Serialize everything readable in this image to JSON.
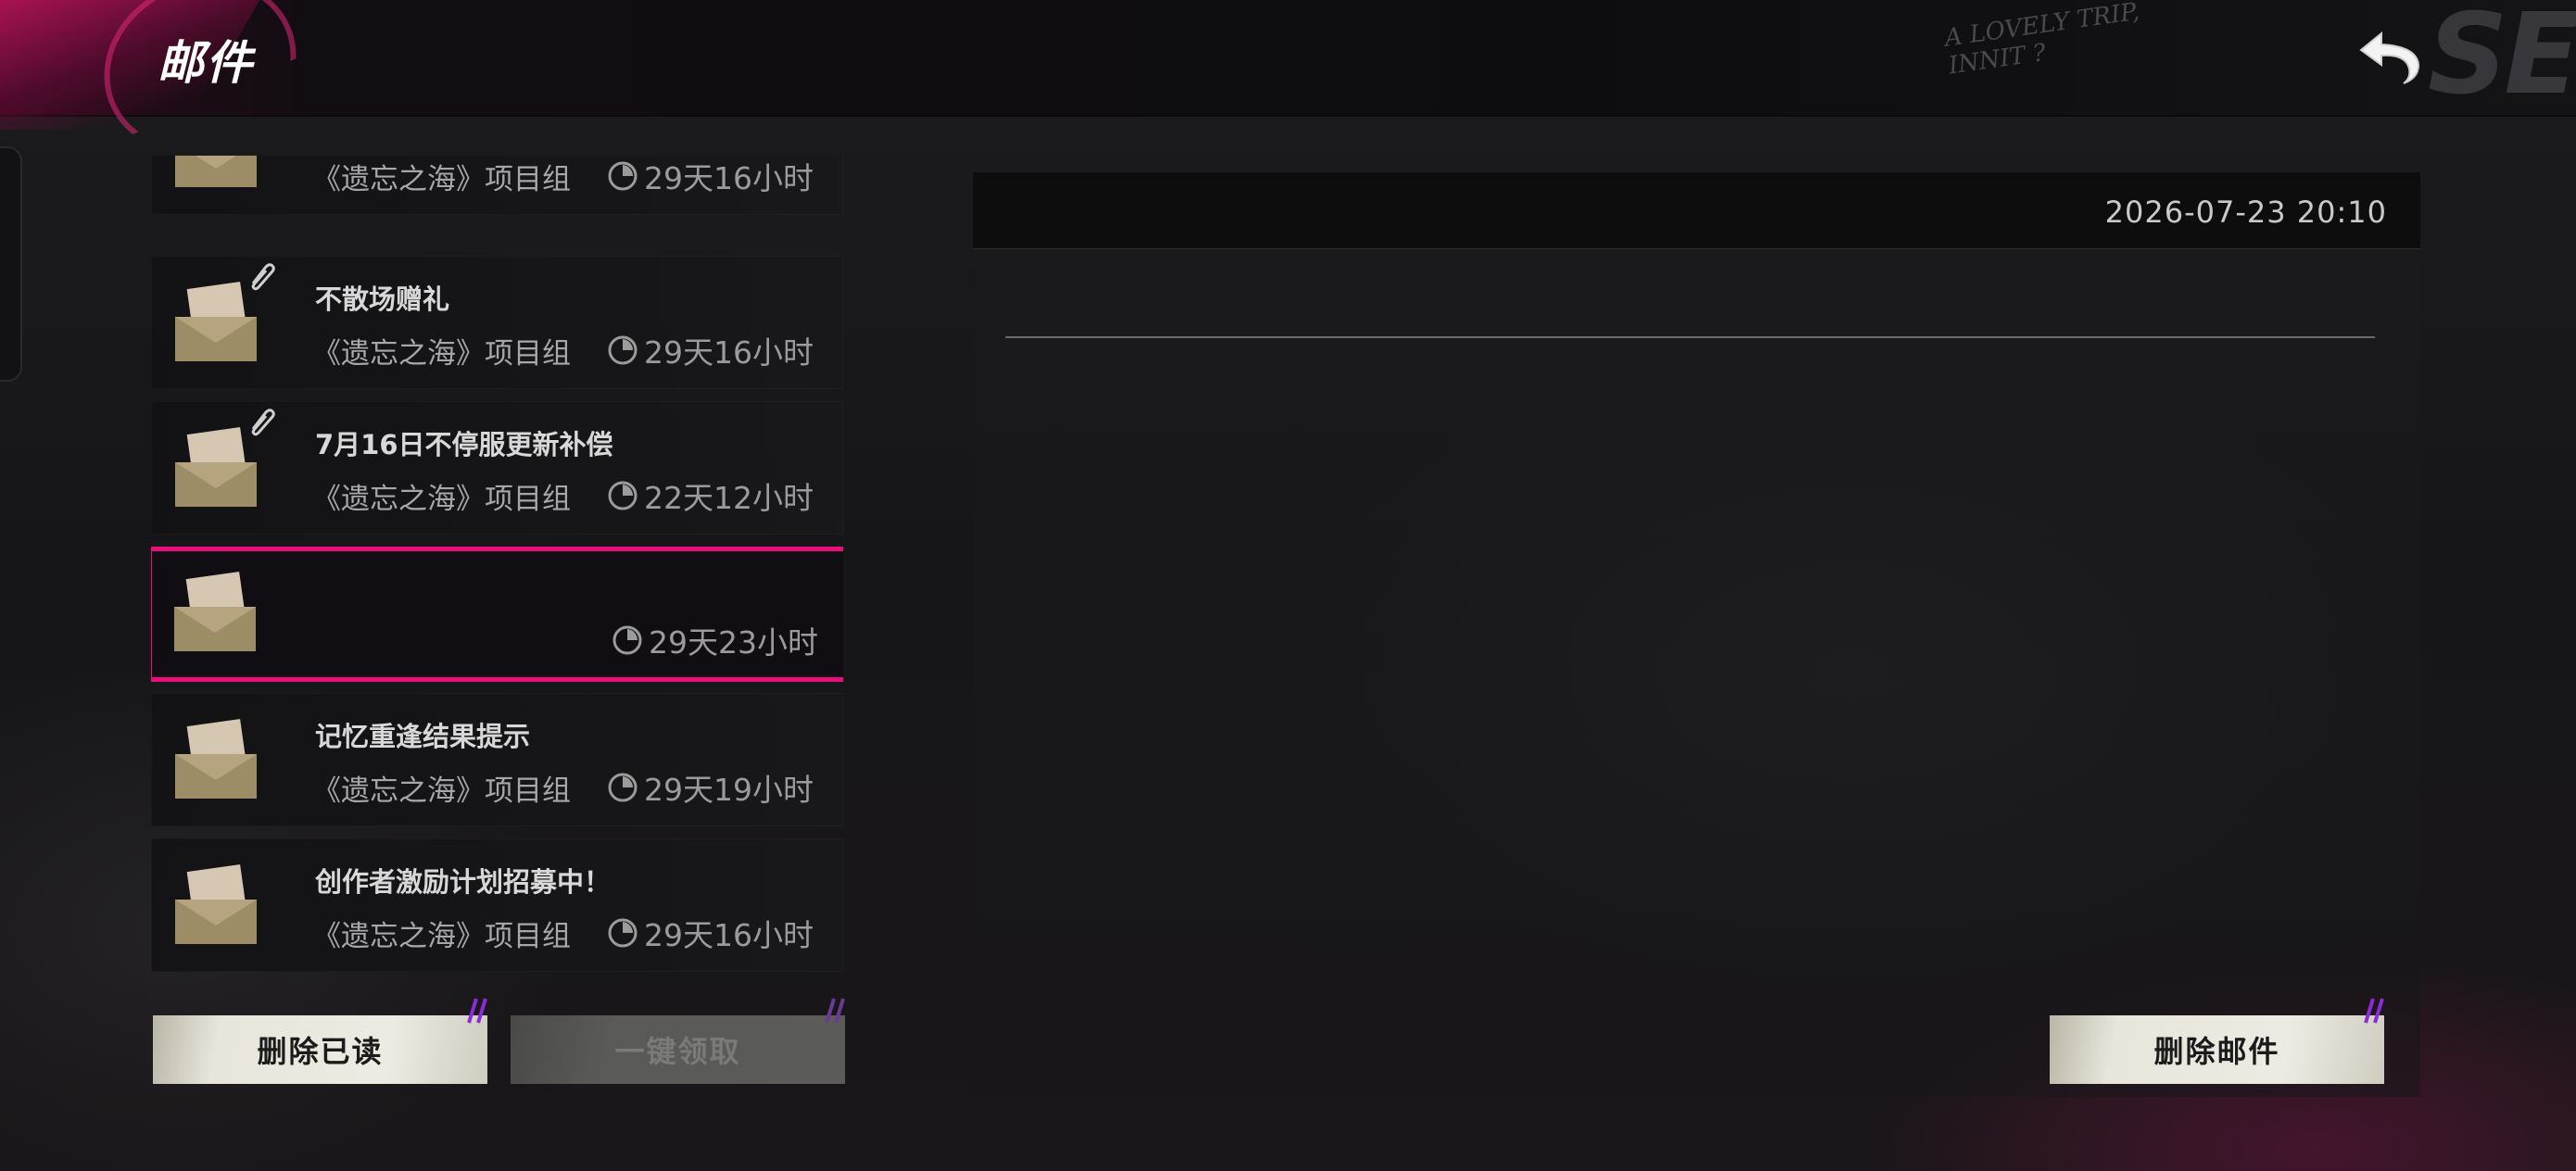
{
  "header": {
    "title": "邮件",
    "deco_lines": [
      "A LOVELY TRIP,",
      "INNIT ?"
    ],
    "deco_mark": "SE"
  },
  "colors": {
    "accent_pink": "#ea0f78",
    "accent_purple": "#8a2bd6",
    "button_light": "#ecebe3"
  },
  "mails": [
    {
      "title": "",
      "sender": "《遗忘之海》项目组",
      "time": "29天16小时",
      "has_attachment": false,
      "selected": false
    },
    {
      "title": "不散场赠礼",
      "sender": "《遗忘之海》项目组",
      "time": "29天16小时",
      "has_attachment": true,
      "selected": false
    },
    {
      "title": "7月16日不停服更新补偿",
      "sender": "《遗忘之海》项目组",
      "time": "22天12小时",
      "has_attachment": true,
      "selected": false
    },
    {
      "title": "",
      "sender": "",
      "time": "29天23小时",
      "has_attachment": false,
      "selected": true
    },
    {
      "title": "记忆重逢结果提示",
      "sender": "《遗忘之海》项目组",
      "time": "29天19小时",
      "has_attachment": false,
      "selected": false
    },
    {
      "title": "创作者激励计划招募中！",
      "sender": "《遗忘之海》项目组",
      "time": "29天16小时",
      "has_attachment": false,
      "selected": false
    }
  ],
  "detail": {
    "date": "2026-07-23 20:10"
  },
  "buttons": {
    "delete_read": "删除已读",
    "claim_all": "一键领取",
    "delete_mail": "删除邮件"
  }
}
